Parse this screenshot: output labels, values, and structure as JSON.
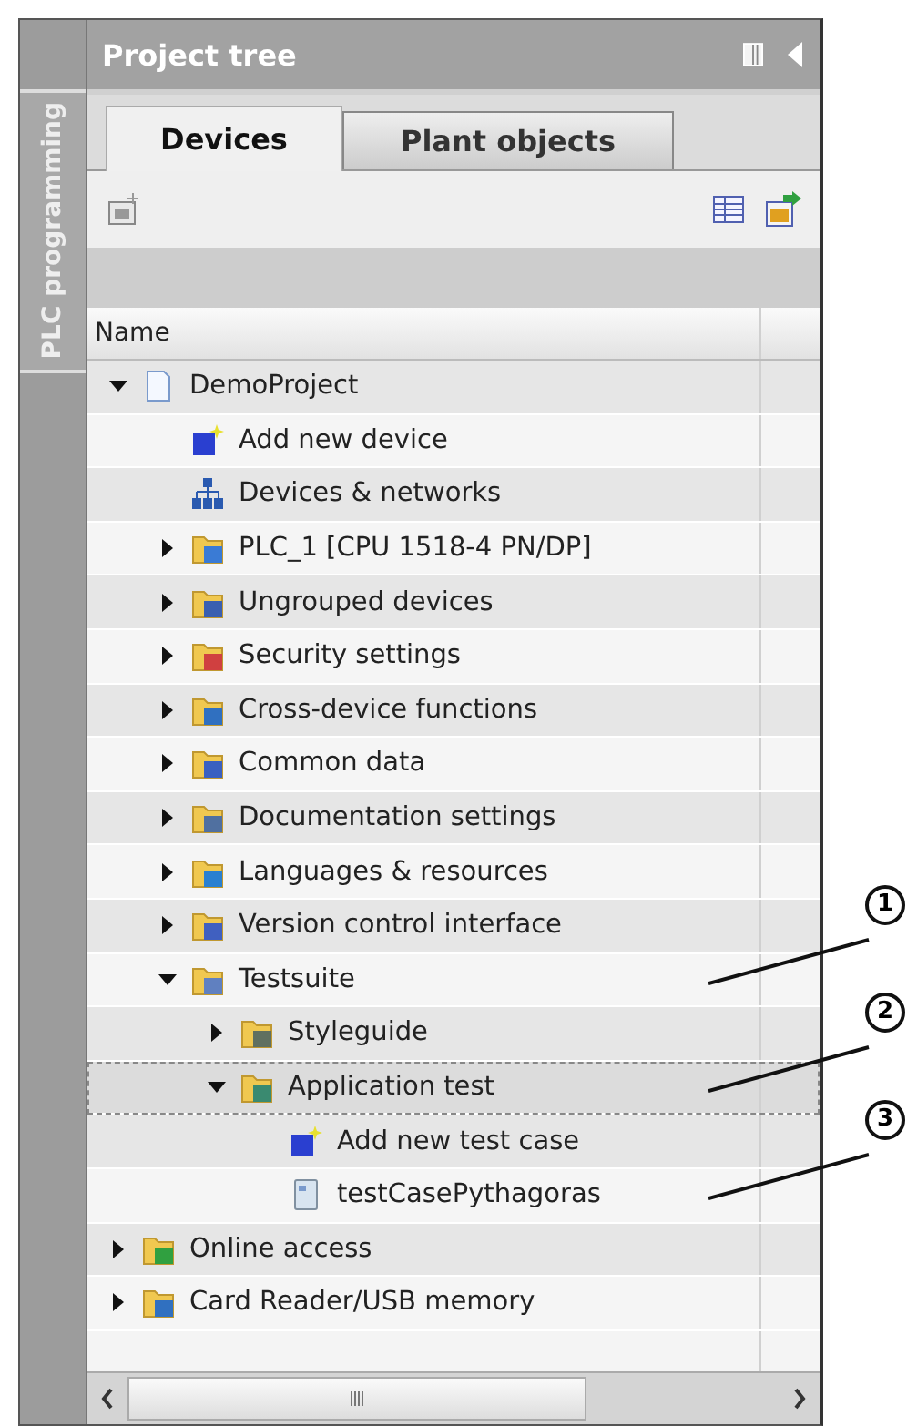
{
  "side_tab": {
    "label": "PLC programming"
  },
  "panel": {
    "title": "Project tree"
  },
  "tabs": [
    {
      "label": "Devices",
      "selected": true
    },
    {
      "label": "Plant objects",
      "selected": false
    }
  ],
  "table": {
    "columns": [
      "Name"
    ]
  },
  "tree": [
    {
      "label": "DemoProject",
      "kind": "project",
      "expanded": true,
      "selected": false,
      "children": [
        {
          "label": "Add new device",
          "kind": "add",
          "selected": false
        },
        {
          "label": "Devices & networks",
          "kind": "network",
          "selected": false
        },
        {
          "label": "PLC_1 [CPU 1518-4 PN/DP]",
          "kind": "plc",
          "expanded": false,
          "selected": false
        },
        {
          "label": "Ungrouped devices",
          "kind": "ungrouped",
          "expanded": false,
          "selected": false
        },
        {
          "label": "Security settings",
          "kind": "security",
          "expanded": false,
          "selected": false
        },
        {
          "label": "Cross-device functions",
          "kind": "cross",
          "expanded": false,
          "selected": false
        },
        {
          "label": "Common data",
          "kind": "common",
          "expanded": false,
          "selected": false
        },
        {
          "label": "Documentation settings",
          "kind": "docs",
          "expanded": false,
          "selected": false
        },
        {
          "label": "Languages & resources",
          "kind": "languages",
          "expanded": false,
          "selected": false
        },
        {
          "label": "Version control interface",
          "kind": "version",
          "expanded": false,
          "selected": false
        },
        {
          "label": "Testsuite",
          "kind": "testsuite",
          "expanded": true,
          "selected": false,
          "callout": "1",
          "children": [
            {
              "label": "Styleguide",
              "kind": "styleguide",
              "expanded": false,
              "selected": false
            },
            {
              "label": "Application test",
              "kind": "apptest",
              "expanded": true,
              "selected": true,
              "callout": "2",
              "children": [
                {
                  "label": "Add new test case",
                  "kind": "add",
                  "selected": false
                },
                {
                  "label": "testCasePythagoras",
                  "kind": "testcase",
                  "selected": false,
                  "callout": "3"
                }
              ]
            }
          ]
        }
      ]
    },
    {
      "label": "Online access",
      "kind": "online",
      "expanded": false,
      "selected": false
    },
    {
      "label": "Card Reader/USB memory",
      "kind": "card",
      "expanded": false,
      "selected": false
    }
  ]
}
